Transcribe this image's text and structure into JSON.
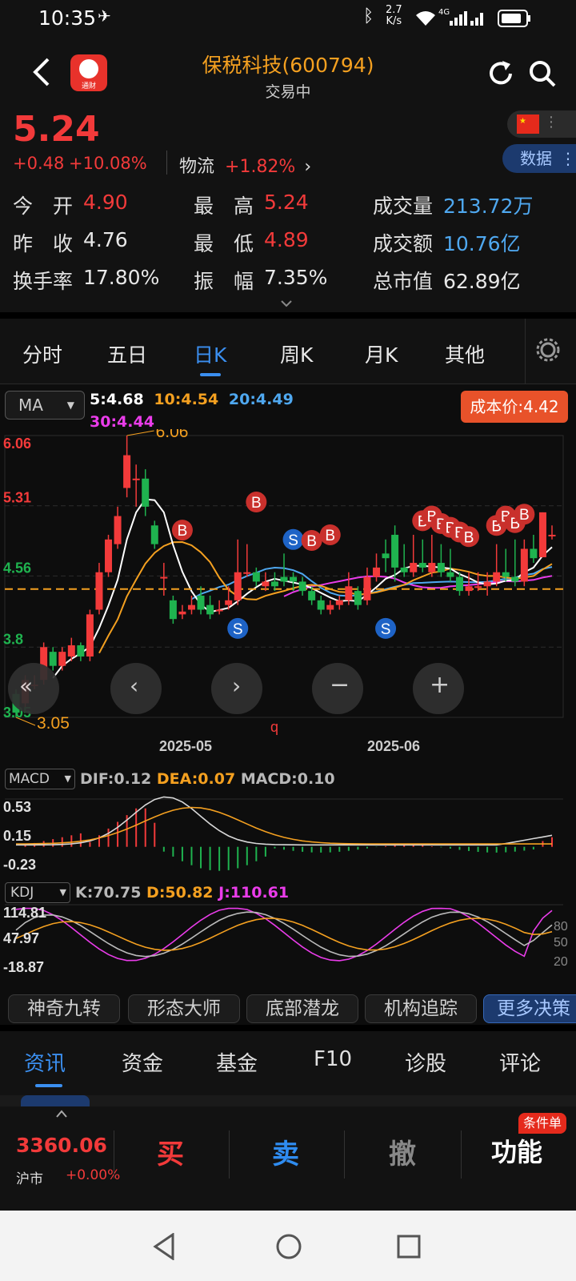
{
  "status": {
    "time": "10:35",
    "net_speed_top": "2.7",
    "net_speed_bottom": "K/s",
    "signal_label": "4G"
  },
  "header": {
    "title": "保税科技(600794)",
    "subtitle": "交易中",
    "app_logo_label": "通财"
  },
  "quote": {
    "price": "5.24",
    "change": "+0.48",
    "change_pct": "+10.08%",
    "sector_name": "物流",
    "sector_pct": "+1.82%",
    "data_button": "数据",
    "rows": [
      [
        {
          "label": "今　开",
          "value": "4.90",
          "color": "#f23a3a"
        },
        {
          "label": "最　高",
          "value": "5.24",
          "color": "#f23a3a"
        },
        {
          "label": "成交量",
          "value": "213.72万",
          "color": "#4fa8f0"
        }
      ],
      [
        {
          "label": "昨　收",
          "value": "4.76",
          "color": "#e8e8e8"
        },
        {
          "label": "最　低",
          "value": "4.89",
          "color": "#f23a3a"
        },
        {
          "label": "成交额",
          "value": "10.76亿",
          "color": "#4fa8f0"
        }
      ],
      [
        {
          "label": "换手率",
          "value": "17.80%",
          "color": "#e8e8e8"
        },
        {
          "label": "振　幅",
          "value": "7.35%",
          "color": "#e8e8e8"
        },
        {
          "label": "总市值",
          "value": "62.89亿",
          "color": "#e8e8e8"
        }
      ]
    ]
  },
  "tabs": [
    "分时",
    "五日",
    "日K",
    "周K",
    "月K",
    "其他"
  ],
  "active_tab": "日K",
  "ma": {
    "selector": "MA",
    "ma5": "5:4.68",
    "ma10": "10:4.54",
    "ma20": "20:4.49",
    "ma30": "30:4.44",
    "cost_label": "成本价:4.42",
    "y_labels": [
      "6.06",
      "5.31",
      "4.56",
      "3.8",
      "3.05"
    ],
    "high_annot": "6.06",
    "low_annot": "3.05",
    "stray_mark": "q",
    "dates": [
      "2025-05",
      "2025-06"
    ]
  },
  "macd": {
    "selector": "MACD",
    "dif": "DIF:0.12",
    "dea": "DEA:0.07",
    "macd": "MACD:0.10",
    "y_labels": [
      "0.53",
      "0.15",
      "-0.23"
    ]
  },
  "kdj": {
    "selector": "KDJ",
    "k": "K:70.75",
    "d": "D:50.82",
    "j": "J:110.61",
    "y_labels": [
      "114.81",
      "47.97",
      "-18.87"
    ],
    "right_labels": [
      "80",
      "50",
      "20"
    ]
  },
  "features": [
    "神奇九转",
    "形态大师",
    "底部潜龙",
    "机构追踪",
    "更多决策"
  ],
  "bottom_tabs": [
    "资讯",
    "资金",
    "基金",
    "F10",
    "诊股",
    "评论"
  ],
  "active_bottom": "资讯",
  "trade": {
    "index_value": "3360.06",
    "index_name": "沪市",
    "index_pct": "+0.00%",
    "buy": "买",
    "sell": "卖",
    "cancel": "撤",
    "func": "功能",
    "func_badge": "条件单"
  },
  "chart_data": {
    "type": "candlestick",
    "ylim": [
      3.05,
      6.06
    ],
    "candles": [
      [
        3.3,
        3.1,
        3.35,
        3.05
      ],
      [
        3.2,
        3.45,
        3.5,
        3.15
      ],
      [
        3.4,
        3.4,
        3.5,
        3.35
      ],
      [
        3.45,
        3.8,
        3.85,
        3.4
      ],
      [
        3.75,
        3.6,
        3.8,
        3.55
      ],
      [
        3.6,
        3.75,
        3.8,
        3.55
      ],
      [
        3.7,
        3.82,
        3.9,
        3.65
      ],
      [
        3.82,
        3.7,
        3.85,
        3.65
      ],
      [
        3.7,
        4.15,
        4.2,
        3.65
      ],
      [
        4.2,
        4.6,
        4.7,
        4.15
      ],
      [
        4.6,
        4.95,
        5.0,
        4.55
      ],
      [
        4.9,
        5.2,
        5.3,
        4.85
      ],
      [
        5.5,
        5.85,
        6.06,
        5.4
      ],
      [
        5.6,
        5.6,
        5.75,
        5.3
      ],
      [
        5.6,
        5.3,
        5.7,
        5.2
      ],
      [
        5.1,
        4.9,
        5.15,
        4.85
      ],
      [
        4.55,
        4.55,
        4.7,
        4.35
      ],
      [
        4.3,
        4.1,
        4.35,
        4.05
      ],
      [
        4.15,
        4.18,
        4.25,
        4.1
      ],
      [
        4.2,
        4.25,
        4.35,
        4.15
      ],
      [
        4.35,
        4.2,
        4.45,
        4.15
      ],
      [
        4.25,
        4.15,
        4.35,
        4.1
      ],
      [
        4.2,
        4.2,
        4.3,
        4.15
      ],
      [
        4.25,
        4.3,
        4.45,
        4.2
      ],
      [
        4.3,
        4.6,
        4.95,
        4.25
      ],
      [
        4.6,
        4.6,
        4.9,
        4.55
      ],
      [
        4.6,
        4.5,
        4.65,
        4.45
      ],
      [
        4.45,
        4.5,
        4.6,
        4.4
      ],
      [
        4.5,
        4.45,
        4.6,
        4.4
      ],
      [
        4.55,
        4.5,
        4.8,
        4.45
      ],
      [
        4.55,
        4.5,
        4.6,
        4.4
      ],
      [
        4.5,
        4.4,
        4.55,
        4.35
      ],
      [
        4.4,
        4.3,
        4.45,
        4.25
      ],
      [
        4.3,
        4.2,
        4.35,
        4.15
      ],
      [
        4.2,
        4.25,
        4.3,
        4.15
      ],
      [
        4.25,
        4.3,
        4.35,
        4.2
      ],
      [
        4.3,
        4.45,
        4.6,
        4.25
      ],
      [
        4.4,
        4.25,
        4.45,
        4.2
      ],
      [
        4.3,
        4.55,
        4.65,
        4.25
      ],
      [
        4.55,
        4.65,
        4.8,
        4.5
      ],
      [
        4.8,
        4.75,
        4.95,
        4.6
      ],
      [
        5.0,
        4.65,
        5.1,
        4.5
      ],
      [
        4.65,
        4.6,
        4.9,
        4.55
      ],
      [
        4.6,
        4.7,
        5.0,
        4.55
      ],
      [
        4.7,
        4.65,
        4.95,
        4.6
      ],
      [
        4.6,
        4.7,
        5.0,
        4.55
      ],
      [
        4.7,
        4.6,
        4.9,
        4.55
      ],
      [
        4.6,
        4.55,
        4.85,
        4.5
      ],
      [
        4.55,
        4.4,
        4.6,
        4.35
      ],
      [
        4.4,
        4.45,
        4.6,
        4.35
      ],
      [
        4.45,
        4.45,
        4.6,
        4.4
      ],
      [
        4.45,
        4.5,
        4.6,
        4.35
      ],
      [
        4.5,
        4.6,
        4.9,
        4.45
      ],
      [
        4.6,
        4.55,
        4.85,
        4.5
      ],
      [
        4.55,
        4.5,
        4.95,
        4.45
      ],
      [
        4.5,
        4.85,
        4.95,
        4.45
      ],
      [
        4.85,
        4.75,
        5.0,
        4.7
      ],
      [
        4.76,
        5.24,
        5.24,
        4.89
      ],
      [
        5.0,
        5.0,
        5.1,
        4.95
      ]
    ]
  }
}
